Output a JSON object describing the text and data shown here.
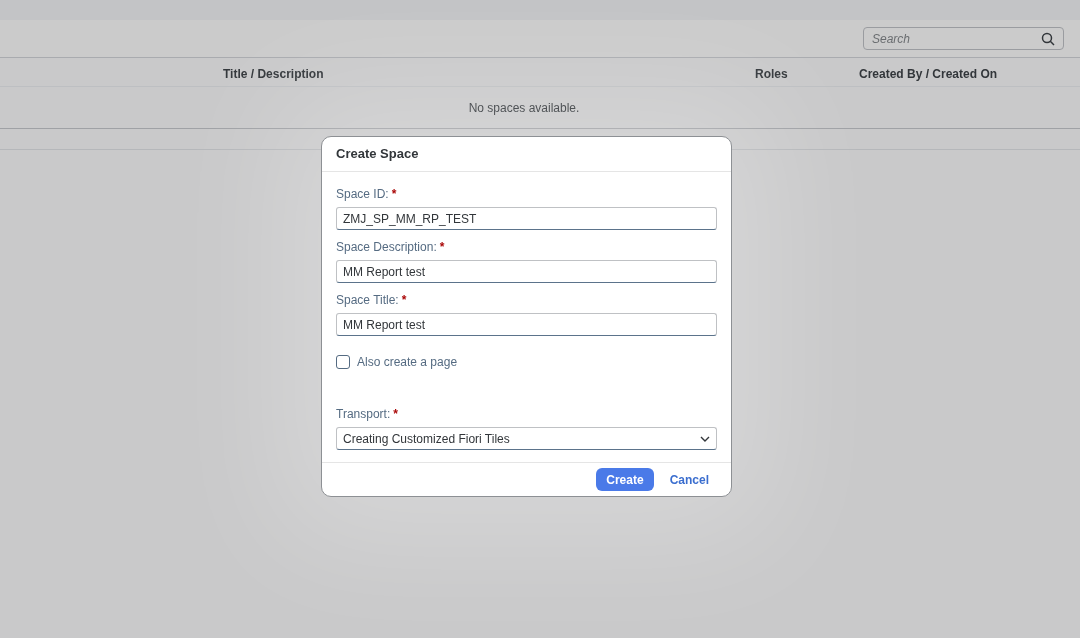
{
  "search": {
    "placeholder": "Search"
  },
  "table": {
    "columns": [
      "Title / Description",
      "Roles",
      "Created By / Created On"
    ],
    "empty_text": "No spaces available."
  },
  "dialog": {
    "title": "Create Space",
    "fields": [
      {
        "kind": "input",
        "label": "Space ID:",
        "required_mark": "*",
        "value": "ZMJ_SP_MM_RP_TEST"
      },
      {
        "kind": "input",
        "label": "Space Description:",
        "required_mark": "*",
        "value": "MM Report test"
      },
      {
        "kind": "input",
        "label": "Space Title:",
        "required_mark": "*",
        "value": "MM Report test"
      },
      {
        "kind": "checkbox",
        "label": "Also create a page",
        "checked": false
      },
      {
        "kind": "select",
        "label": "Transport:",
        "required_mark": "*",
        "value": "Creating Customized Fiori Tiles"
      }
    ],
    "buttons": [
      {
        "kind": "primary",
        "label": "Create"
      },
      {
        "kind": "link",
        "label": "Cancel"
      }
    ]
  }
}
